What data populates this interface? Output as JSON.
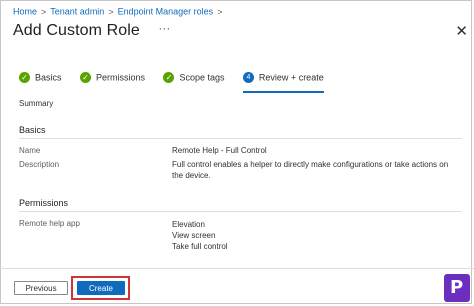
{
  "breadcrumb": {
    "items": [
      "Home",
      "Tenant admin",
      "Endpoint Manager roles"
    ],
    "separator": ">"
  },
  "header": {
    "title": "Add Custom Role",
    "more": "···",
    "close": "✕"
  },
  "steps": [
    {
      "label": "Basics",
      "icon": "✓"
    },
    {
      "label": "Permissions",
      "icon": "✓"
    },
    {
      "label": "Scope tags",
      "icon": "✓"
    },
    {
      "label": "Review + create",
      "icon": "4"
    }
  ],
  "summary": {
    "label": "Summary",
    "basics": {
      "heading": "Basics",
      "name_key": "Name",
      "name_value": "Remote Help - Full Control",
      "desc_key": "Description",
      "desc_value_line1": "Full control enables a helper to directly make configurations or take actions on",
      "desc_value_line2": "the device."
    },
    "permissions": {
      "heading": "Permissions",
      "app_key": "Remote help app",
      "values": [
        "Elevation",
        "View screen",
        "Take full control"
      ]
    }
  },
  "footer": {
    "previous_label": "Previous",
    "create_label": "Create"
  },
  "colors": {
    "accent": "#0f6cbd",
    "success": "#57a300",
    "highlight": "#d13438",
    "logo": "#6b2fbf"
  }
}
